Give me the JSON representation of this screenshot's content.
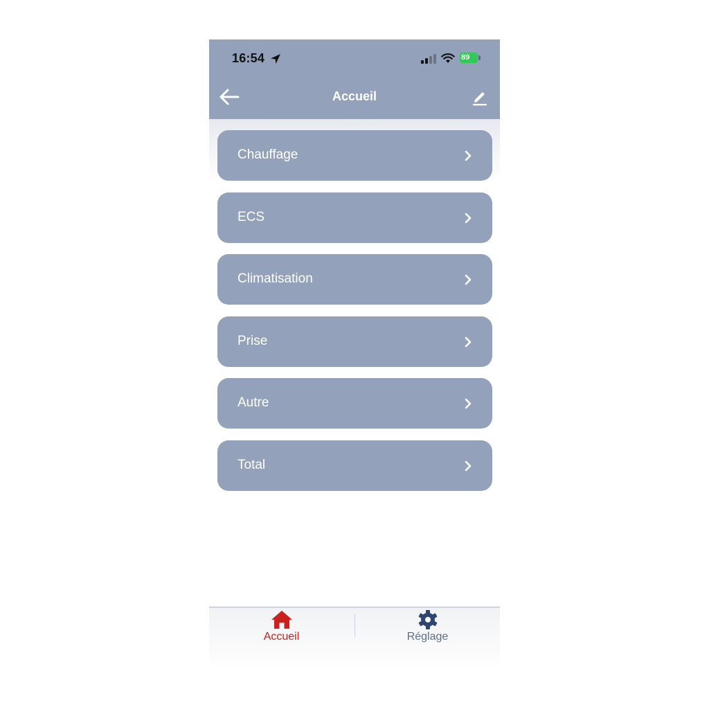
{
  "status_bar": {
    "time": "16:54",
    "battery": "89"
  },
  "nav": {
    "title": "Accueil"
  },
  "menu": {
    "items": [
      {
        "label": "Chauffage"
      },
      {
        "label": "ECS"
      },
      {
        "label": "Climatisation"
      },
      {
        "label": "Prise"
      },
      {
        "label": "Autre"
      },
      {
        "label": "Total"
      }
    ]
  },
  "tabbar": {
    "tabs": [
      {
        "label": "Accueil",
        "active": true
      },
      {
        "label": "Réglage",
        "active": false
      }
    ]
  },
  "colors": {
    "header": "#93a1ba",
    "menu_item": "#93a1ba",
    "active_tab": "#c9211e",
    "inactive_tab": "#5a6d88",
    "battery": "#34c759"
  }
}
